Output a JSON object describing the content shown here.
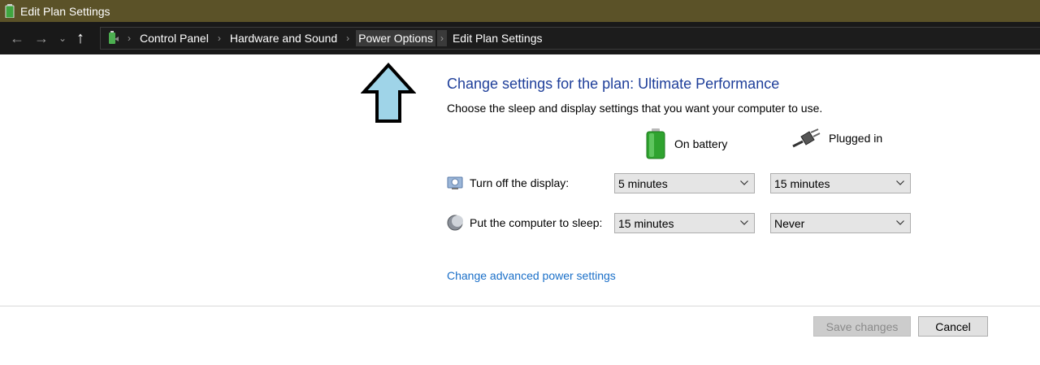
{
  "window": {
    "title": "Edit Plan Settings"
  },
  "nav": {
    "back_glyph": "←",
    "forward_glyph": "→",
    "dropdown_glyph": "⌄",
    "up_glyph": "↑",
    "breadcrumb": [
      "Control Panel",
      "Hardware and Sound",
      "Power Options",
      "Edit Plan Settings"
    ],
    "separator": "›"
  },
  "main": {
    "heading": "Change settings for the plan: Ultimate Performance",
    "subtext": "Choose the sleep and display settings that you want your computer to use.",
    "columns": {
      "battery": "On battery",
      "plugged": "Plugged in"
    },
    "rows": [
      {
        "label": "Turn off the display:",
        "battery": "5 minutes",
        "plugged": "15 minutes"
      },
      {
        "label": "Put the computer to sleep:",
        "battery": "15 minutes",
        "plugged": "Never"
      }
    ],
    "advanced_link": "Change advanced power settings"
  },
  "footer": {
    "save_label": "Save changes",
    "cancel_label": "Cancel"
  },
  "colors": {
    "titlebar": "#5b5228",
    "navbar": "#191919",
    "heading": "#1f3f9a",
    "link": "#1a6fc8",
    "annotation_arrow": "#9fd4e8"
  }
}
